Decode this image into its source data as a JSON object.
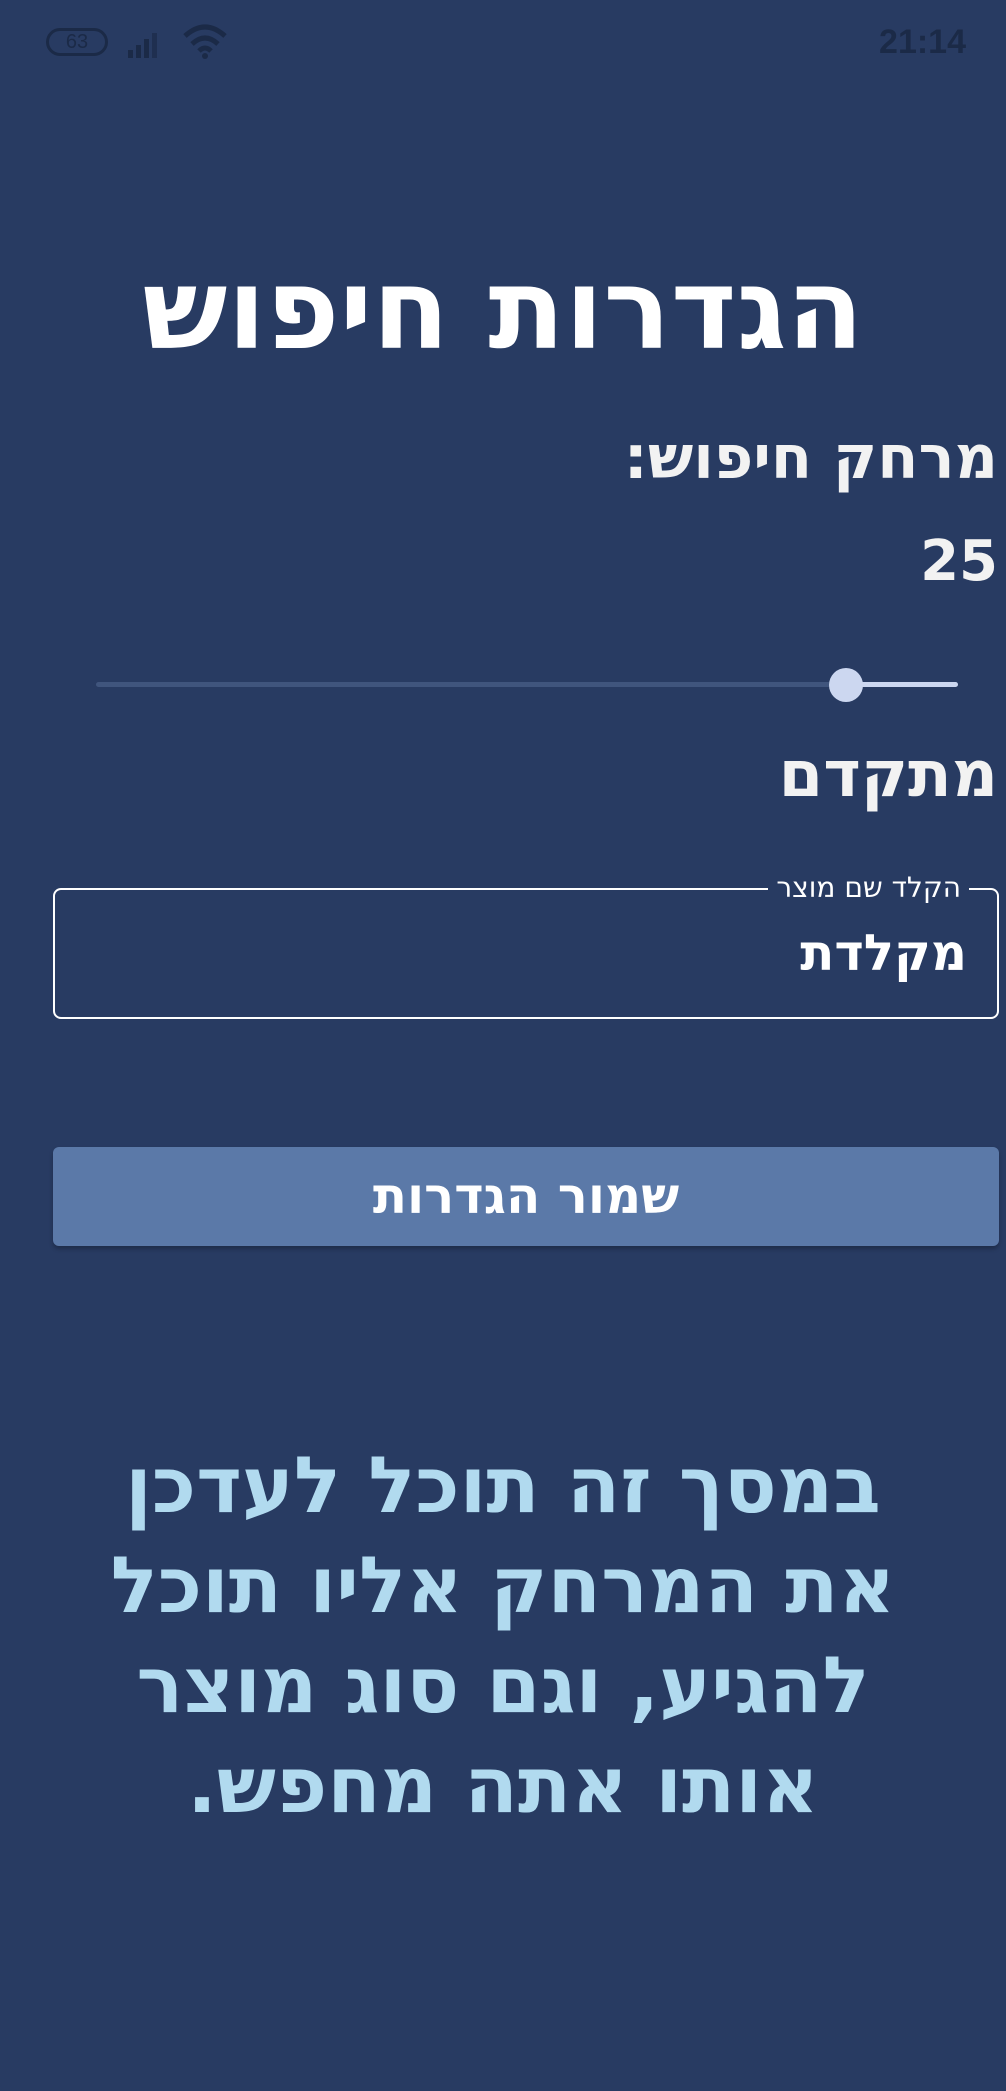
{
  "status_bar": {
    "battery": "63",
    "time": "21:14",
    "signal_icon": "signal-icon",
    "wifi_icon": "wifi-icon"
  },
  "title": "הגדרות חיפוש",
  "distance": {
    "label": "מרחק חיפוש:",
    "value": "25",
    "slider_fraction": 0.87
  },
  "mode": {
    "label": "מתקדם"
  },
  "product": {
    "label": "הקלד שם מוצר",
    "value": "מקלדת"
  },
  "save_button": {
    "label": "שמור הגדרות"
  },
  "info": {
    "text": "במסך זה תוכל לעדכן את המרחק אליו תוכל להגיע, וגם סוג מוצר אותו אתה מחפש."
  },
  "colors": {
    "background": "#283b62",
    "button": "#5b79a8",
    "info_text": "#b1daef",
    "slider_active": "#ccd7f0"
  }
}
